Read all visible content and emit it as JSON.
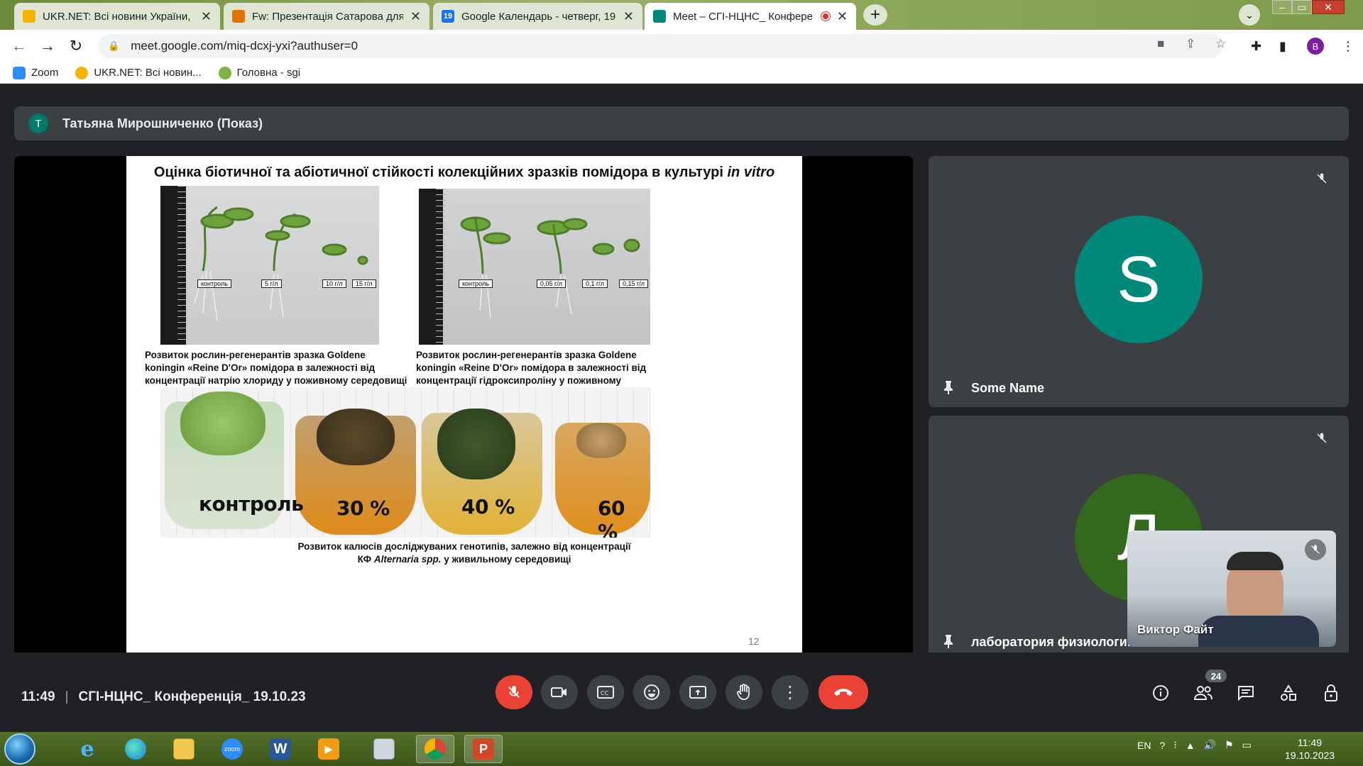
{
  "browser": {
    "tabs": [
      {
        "title": "UKR.NET: Всі новини України, ос",
        "icon": "ukrnet-favicon",
        "color": "#f4b400"
      },
      {
        "title": "Fw: Презентація Сатарова для С",
        "icon": "mail-favicon",
        "color": "#e37400"
      },
      {
        "title": "Google Календарь - четверг, 19",
        "icon": "calendar-favicon",
        "color": "#1a73e8"
      },
      {
        "title": "Meet – СГІ-НЦНС_ Конфере",
        "icon": "meet-favicon",
        "color": "#00897b"
      }
    ],
    "new_tab": "+",
    "url": "meet.google.com/miq-dcxj-yxi?authuser=0",
    "profile_initial": "B",
    "bookmarks": [
      {
        "label": "Zoom",
        "color": "#2d8cff"
      },
      {
        "label": "UKR.NET: Всі новин...",
        "color": "#f4b400"
      },
      {
        "label": "Головна - sgi",
        "color": "#7cb342"
      }
    ]
  },
  "meet": {
    "presenter_initial": "T",
    "presenter_label": "Татьяна Мирошниченко (Показ)",
    "slide": {
      "title_main": "Оцінка біотичної та абіотичної стійкості  колекційних зразків помідора в культурі ",
      "title_italic": "in vitro",
      "left_tags": [
        "контроль",
        "5 г/л",
        "10 г/л",
        "15 г/л"
      ],
      "right_tags": [
        "контроль",
        "0,05 г/л",
        "0,1 г/л",
        "0,15 г/л"
      ],
      "caption_left": "Розвиток рослин-регенерантів зразка Goldene koningin «Reine D'Or» помідора в залежності від концентрації натрію хлориду у поживному середовищі",
      "caption_right": "Розвиток рослин-регенерантів зразка Goldene koningin «Reine D'Or» помідора в залежності від концентрації гідроксипроліну у поживному середовищі",
      "flask_labels": [
        "контроль",
        "30 %",
        "40 %",
        "60 %"
      ],
      "caption_bottom_1": "Розвиток калюсів досліджуваних генотипів, залежно від концентрації",
      "caption_bottom_2a": "КФ ",
      "caption_bottom_2b": "Alternaria spp.",
      "caption_bottom_2c": " у живильному середовищі",
      "page_number": "12"
    },
    "participants": [
      {
        "initial": "S",
        "name": "Some Name",
        "avatar_color": "#00897b"
      },
      {
        "initial": "Л",
        "name": "лаборатория физиологии",
        "avatar_color": "#33691e"
      }
    ],
    "self_view_name": "Виктор Файт",
    "clock": "11:49",
    "meeting_title": "СГІ-НЦНС_ Конференція_ 19.10.23",
    "people_count": "24"
  },
  "taskbar": {
    "language": "EN",
    "time": "11:49",
    "date": "19.10.2023",
    "zoom_label": "zoom",
    "word_label": "W"
  }
}
